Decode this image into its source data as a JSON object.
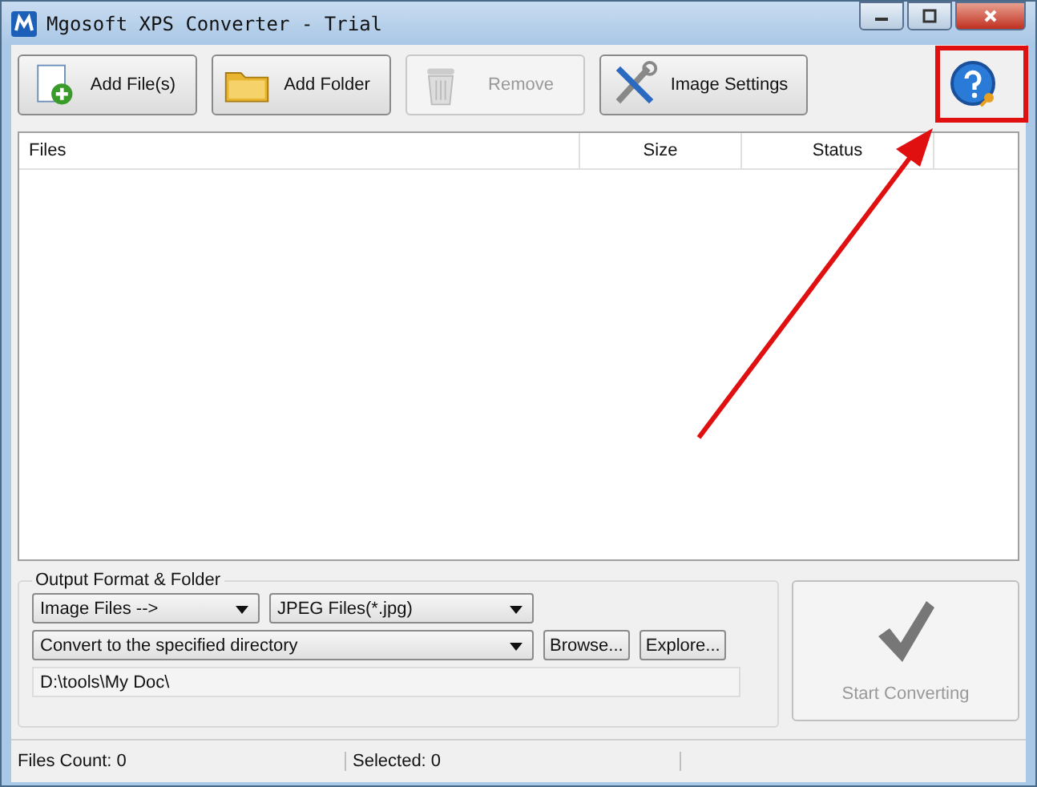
{
  "window": {
    "title": "Mgosoft XPS Converter - Trial"
  },
  "toolbar": [
    {
      "kind": "add-file",
      "label": "Add File(s)",
      "disabled": false
    },
    {
      "kind": "add-folder",
      "label": "Add Folder",
      "disabled": false
    },
    {
      "kind": "remove",
      "label": "Remove",
      "disabled": true
    },
    {
      "kind": "settings",
      "label": "Image Settings",
      "disabled": false
    }
  ],
  "table": {
    "columns": [
      "Files",
      "Size",
      "Status"
    ]
  },
  "output": {
    "title": "Output Format & Folder",
    "format": "Image Files -->",
    "type": "JPEG Files(*.jpg)",
    "destination": "Convert to the specified directory",
    "buttons": [
      "Browse...",
      "Explore..."
    ],
    "path": "D:\\tools\\My Doc\\"
  },
  "start": {
    "label": "Start Converting",
    "disabled": true
  },
  "status_bar": [
    "Files Count: 0",
    "Selected: 0"
  ],
  "annotation": {
    "highlight": true
  }
}
